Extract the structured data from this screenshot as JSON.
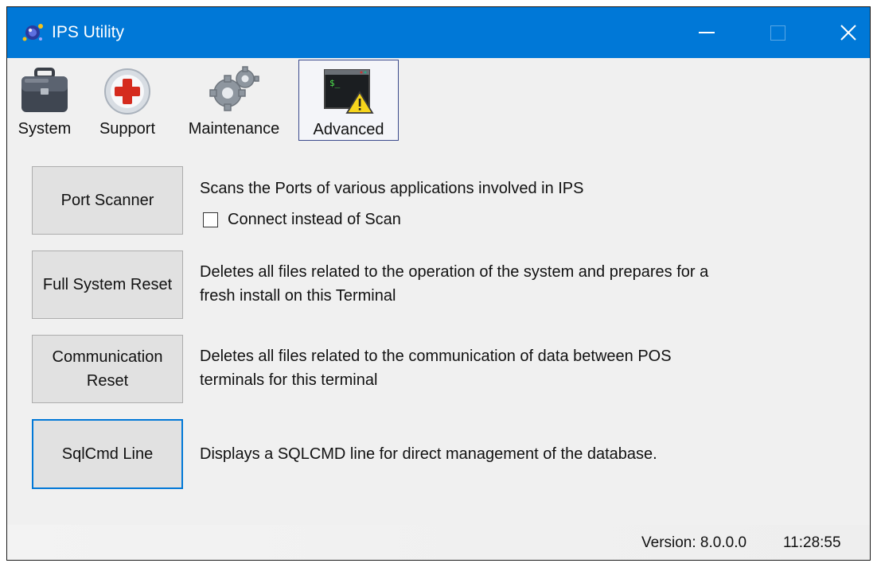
{
  "window": {
    "title": "IPS Utility"
  },
  "toolbar": {
    "tabs": [
      {
        "label": "System",
        "icon": "briefcase-icon"
      },
      {
        "label": "Support",
        "icon": "first-aid-icon"
      },
      {
        "label": "Maintenance",
        "icon": "gears-icon"
      },
      {
        "label": "Advanced",
        "icon": "terminal-warning-icon",
        "selected": true
      }
    ]
  },
  "actions": [
    {
      "button": "Port Scanner",
      "description": "Scans the Ports of various applications involved in IPS"
    },
    {
      "button": "Full System Reset",
      "description_lines": [
        "Deletes all files related to the operation of the system and prepares for a",
        "fresh install on this Terminal"
      ]
    },
    {
      "button_lines": [
        "Communication",
        "Reset"
      ],
      "description_lines": [
        "Deletes all files related to the communication of data between POS",
        "terminals for this terminal"
      ]
    },
    {
      "button": "SqlCmd Line",
      "description": "Displays a SQLCMD line for direct management of the database.",
      "focused": true
    }
  ],
  "options": {
    "connect_instead_label": "Connect instead of Scan",
    "connect_instead_checked": false
  },
  "status": {
    "version": "Version: 8.0.0.0",
    "time": "11:28:55"
  },
  "colors": {
    "titlebar": "#0078d7",
    "focus": "#0078d7",
    "button_face": "#e1e1e1",
    "background": "#f0f0f0"
  }
}
